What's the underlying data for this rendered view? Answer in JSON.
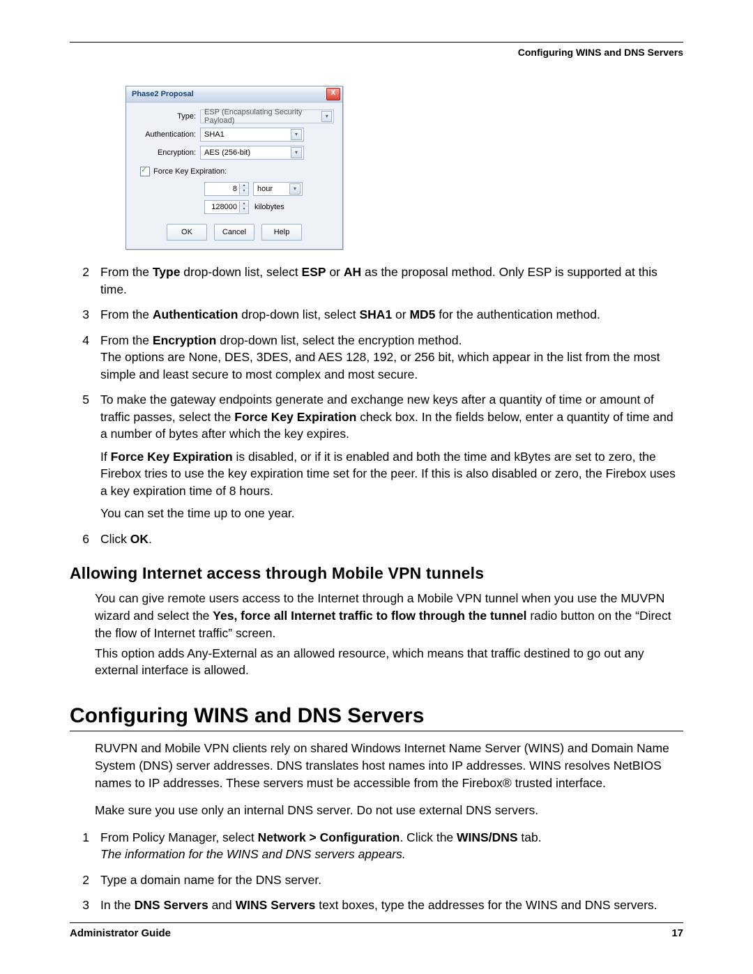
{
  "runningHead": "Configuring WINS and DNS Servers",
  "dialog": {
    "title": "Phase2 Proposal",
    "closeGlyph": "X",
    "typeLabel": "Type:",
    "typeValue": "ESP (Encapsulating Security Payload)",
    "authLabel": "Authentication:",
    "authValue": "SHA1",
    "encLabel": "Encryption:",
    "encValue": "AES (256-bit)",
    "forceLabel": "Force Key Expiration:",
    "timeValue": "8",
    "timeUnit": "hour",
    "bytesValue": "128000",
    "bytesUnit": "kilobytes",
    "ok": "OK",
    "cancel": "Cancel",
    "help": "Help"
  },
  "stepsA": [
    {
      "n": "2",
      "parts": [
        {
          "t": "From the "
        },
        {
          "b": "Type"
        },
        {
          "t": " drop-down list, select "
        },
        {
          "b": "ESP"
        },
        {
          "t": " or "
        },
        {
          "b": "AH"
        },
        {
          "t": " as the proposal method. Only ESP is supported at this time."
        }
      ]
    },
    {
      "n": "3",
      "parts": [
        {
          "t": "From the "
        },
        {
          "b": "Authentication"
        },
        {
          "t": " drop-down list, select "
        },
        {
          "b": "SHA1"
        },
        {
          "t": " or "
        },
        {
          "b": "MD5"
        },
        {
          "t": " for the authentication method."
        }
      ]
    },
    {
      "n": "4",
      "parts": [
        {
          "t": "From the "
        },
        {
          "b": "Encryption"
        },
        {
          "t": " drop-down list, select the encryption method."
        }
      ],
      "extra": [
        {
          "t": "The options are None, DES, 3DES, and AES 128, 192, or 256 bit, which appear in the list from the most simple and least secure to most complex and most secure."
        }
      ]
    },
    {
      "n": "5",
      "parts": [
        {
          "t": "To make the gateway endpoints generate and exchange new keys after a quantity of time or amount of traffic passes, select the "
        },
        {
          "b": "Force Key Expiration"
        },
        {
          "t": " check box. In the fields below, enter a quantity of time and a number of bytes after which the key expires."
        }
      ],
      "sub": [
        [
          {
            "t": "If "
          },
          {
            "b": "Force Key Expiration"
          },
          {
            "t": " is disabled, or if it is enabled and both the time and kBytes are set to zero, the Firebox tries to use the key expiration time set for the peer. If this is also disabled or zero, the Firebox uses a key expiration time of 8 hours."
          }
        ],
        [
          {
            "t": "You can set the time up to one year."
          }
        ]
      ]
    },
    {
      "n": "6",
      "parts": [
        {
          "t": "Click "
        },
        {
          "b": "OK"
        },
        {
          "t": "."
        }
      ]
    }
  ],
  "h2": "Allowing Internet access through Mobile VPN tunnels",
  "p1": [
    {
      "t": "You can give remote users access to the Internet through a Mobile VPN tunnel when you use the MUVPN wizard and select the "
    },
    {
      "b": "Yes, force all Internet traffic to flow through the tunnel"
    },
    {
      "t": " radio button on the “Direct the flow of Internet traffic” screen."
    }
  ],
  "p1b": "This option adds Any-External as an allowed resource, which means that traffic destined to go out any external interface is allowed.",
  "h1": "Configuring WINS and DNS Servers",
  "p2": "RUVPN and Mobile VPN clients rely on shared Windows Internet Name Server (WINS) and Domain Name System (DNS) server addresses. DNS translates host names into IP addresses. WINS resolves NetBIOS names to IP addresses. These servers must be accessible from the Firebox® trusted interface.",
  "p3": "Make sure you use only an internal DNS server. Do not use external DNS servers.",
  "stepsB": [
    {
      "n": "1",
      "parts": [
        {
          "t": "From Policy Manager, select "
        },
        {
          "b": "Network > Configuration"
        },
        {
          "t": ". Click the "
        },
        {
          "b": "WINS/DNS"
        },
        {
          "t": " tab."
        }
      ],
      "ital": "The information for the WINS and DNS servers appears."
    },
    {
      "n": "2",
      "parts": [
        {
          "t": "Type a domain name for the DNS server."
        }
      ]
    },
    {
      "n": "3",
      "parts": [
        {
          "t": "In the "
        },
        {
          "b": "DNS Servers"
        },
        {
          "t": " and "
        },
        {
          "b": "WINS Servers"
        },
        {
          "t": " text boxes, type the addresses for the WINS and DNS servers."
        }
      ]
    }
  ],
  "footer": {
    "left": "Administrator Guide",
    "right": "17"
  }
}
